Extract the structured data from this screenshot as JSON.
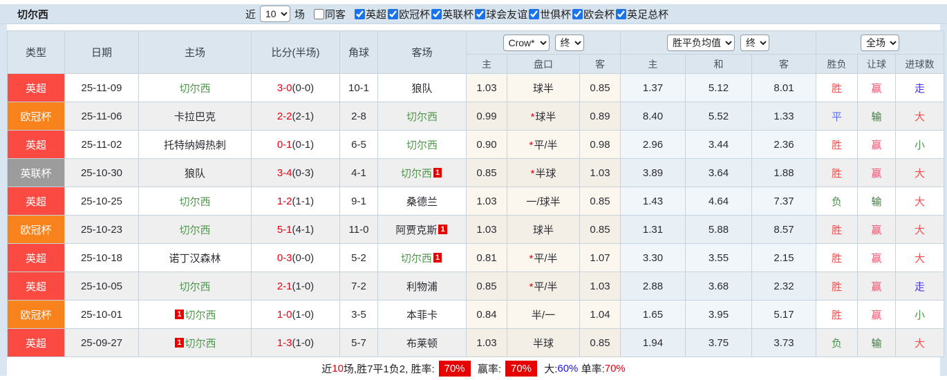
{
  "title": "切尔西",
  "filter": {
    "near_label": "近",
    "near_value": "10",
    "games_label": "场",
    "same_opponent_label": "同客",
    "same_opponent_checked": false,
    "leagues": [
      {
        "label": "英超",
        "checked": true
      },
      {
        "label": "欧冠杯",
        "checked": true
      },
      {
        "label": "英联杯",
        "checked": true
      },
      {
        "label": "球会友谊",
        "checked": true
      },
      {
        "label": "世俱杯",
        "checked": true
      },
      {
        "label": "欧会杯",
        "checked": true
      },
      {
        "label": "英足总杯",
        "checked": true
      }
    ]
  },
  "table": {
    "columns": {
      "type": "类型",
      "date": "日期",
      "home": "主场",
      "score": "比分(半场)",
      "corner": "角球",
      "away": "客场"
    },
    "group_odds": {
      "select1": "Crow*",
      "select2": "终",
      "sub": [
        "主",
        "盘口",
        "客"
      ]
    },
    "group_mean": {
      "select1": "胜平负均值",
      "select2": "终",
      "sub": [
        "主",
        "和",
        "客"
      ]
    },
    "group_result": {
      "select1": "全场",
      "sub": [
        "胜负",
        "让球",
        "进球数"
      ]
    }
  },
  "colors": {
    "英超": "#fb4a42",
    "欧冠杯": "#f8821c",
    "英联杯": "#9c9c9c",
    "胜": "#fa4b4b",
    "平": "#5b6ef0",
    "负": "#4e8f4e",
    "赢": "#ef5470",
    "输": "#3d7a3d",
    "走": "#4635ee",
    "大": "#fa4b4b",
    "小": "#4e8f4e"
  },
  "rows": [
    {
      "type": "英超",
      "date": "25-11-09",
      "home": "切尔西",
      "home_self": true,
      "home_badge": "",
      "score": "3-0",
      "half": "(0-0)",
      "corner": "10-1",
      "away": "狼队",
      "away_self": false,
      "away_badge": "",
      "crow_home": "1.03",
      "star": false,
      "handicap": "球半",
      "crow_away": "0.85",
      "mean": [
        "1.37",
        "5.12",
        "8.01"
      ],
      "results": [
        "胜",
        "赢",
        "走"
      ]
    },
    {
      "type": "欧冠杯",
      "date": "25-11-06",
      "home": "卡拉巴克",
      "home_self": false,
      "home_badge": "",
      "score": "2-2",
      "half": "(2-1)",
      "corner": "2-8",
      "away": "切尔西",
      "away_self": true,
      "away_badge": "",
      "crow_home": "0.99",
      "star": true,
      "handicap": "球半",
      "crow_away": "0.89",
      "mean": [
        "8.40",
        "5.52",
        "1.33"
      ],
      "results": [
        "平",
        "输",
        "大"
      ]
    },
    {
      "type": "英超",
      "date": "25-11-02",
      "home": "托特纳姆热刺",
      "home_self": false,
      "home_badge": "",
      "score": "0-1",
      "half": "(0-1)",
      "corner": "6-5",
      "away": "切尔西",
      "away_self": true,
      "away_badge": "",
      "crow_home": "0.90",
      "star": true,
      "handicap": "平/半",
      "crow_away": "0.98",
      "mean": [
        "2.96",
        "3.44",
        "2.36"
      ],
      "results": [
        "胜",
        "赢",
        "小"
      ]
    },
    {
      "type": "英联杯",
      "date": "25-10-30",
      "home": "狼队",
      "home_self": false,
      "home_badge": "",
      "score": "3-4",
      "half": "(0-3)",
      "corner": "4-1",
      "away": "切尔西",
      "away_self": true,
      "away_badge": "1",
      "crow_home": "0.85",
      "star": true,
      "handicap": "半球",
      "crow_away": "1.03",
      "mean": [
        "3.89",
        "3.64",
        "1.88"
      ],
      "results": [
        "胜",
        "赢",
        "大"
      ]
    },
    {
      "type": "英超",
      "date": "25-10-25",
      "home": "切尔西",
      "home_self": true,
      "home_badge": "",
      "score": "1-2",
      "half": "(1-1)",
      "corner": "9-1",
      "away": "桑德兰",
      "away_self": false,
      "away_badge": "",
      "crow_home": "1.03",
      "star": false,
      "handicap": "一/球半",
      "crow_away": "0.85",
      "mean": [
        "1.43",
        "4.64",
        "7.37"
      ],
      "results": [
        "负",
        "输",
        "大"
      ]
    },
    {
      "type": "欧冠杯",
      "date": "25-10-23",
      "home": "切尔西",
      "home_self": true,
      "home_badge": "",
      "score": "5-1",
      "half": "(4-1)",
      "corner": "11-0",
      "away": "阿贾克斯",
      "away_self": false,
      "away_badge": "1",
      "crow_home": "1.03",
      "star": false,
      "handicap": "球半",
      "crow_away": "0.85",
      "mean": [
        "1.31",
        "5.88",
        "8.57"
      ],
      "results": [
        "胜",
        "赢",
        "大"
      ]
    },
    {
      "type": "英超",
      "date": "25-10-18",
      "home": "诺丁汉森林",
      "home_self": false,
      "home_badge": "",
      "score": "0-3",
      "half": "(0-0)",
      "corner": "5-2",
      "away": "切尔西",
      "away_self": true,
      "away_badge": "1",
      "crow_home": "0.81",
      "star": true,
      "handicap": "平/半",
      "crow_away": "1.07",
      "mean": [
        "3.30",
        "3.55",
        "2.15"
      ],
      "results": [
        "胜",
        "赢",
        "大"
      ]
    },
    {
      "type": "英超",
      "date": "25-10-05",
      "home": "切尔西",
      "home_self": true,
      "home_badge": "",
      "score": "2-1",
      "half": "(1-0)",
      "corner": "7-2",
      "away": "利物浦",
      "away_self": false,
      "away_badge": "",
      "crow_home": "0.85",
      "star": true,
      "handicap": "平/半",
      "crow_away": "1.03",
      "mean": [
        "2.88",
        "3.68",
        "2.32"
      ],
      "results": [
        "胜",
        "赢",
        "走"
      ]
    },
    {
      "type": "欧冠杯",
      "date": "25-10-01",
      "home": "切尔西",
      "home_self": true,
      "home_badge": "1",
      "score": "1-0",
      "half": "(1-0)",
      "corner": "3-5",
      "away": "本菲卡",
      "away_self": false,
      "away_badge": "",
      "crow_home": "0.84",
      "star": false,
      "handicap": "半/一",
      "crow_away": "1.04",
      "mean": [
        "1.65",
        "3.95",
        "5.17"
      ],
      "results": [
        "胜",
        "赢",
        "小"
      ]
    },
    {
      "type": "英超",
      "date": "25-09-27",
      "home": "切尔西",
      "home_self": true,
      "home_badge": "1",
      "score": "1-3",
      "half": "(1-0)",
      "corner": "5-7",
      "away": "布莱顿",
      "away_self": false,
      "away_badge": "",
      "crow_home": "1.03",
      "star": false,
      "handicap": "半球",
      "crow_away": "0.85",
      "mean": [
        "1.94",
        "3.75",
        "3.73"
      ],
      "results": [
        "负",
        "输",
        "大"
      ]
    }
  ],
  "footer": {
    "prefix": "近",
    "count": "10",
    "mid": "场,胜7平1负2, 胜率:",
    "win_rate": "70%",
    "ying_label": " 赢率:",
    "ying_rate": "70%",
    "da_label": " 大:",
    "da_rate": "60%",
    "dan_label": " 单率:",
    "dan_rate": "70%"
  }
}
